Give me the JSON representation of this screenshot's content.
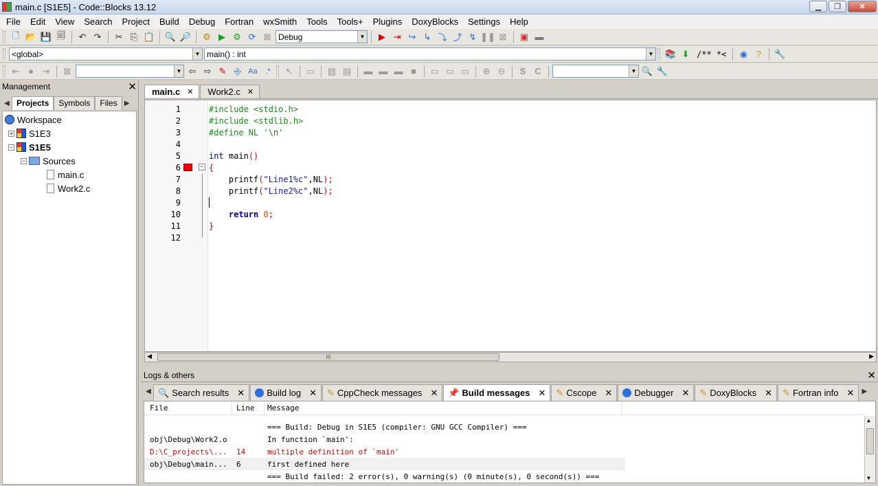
{
  "window": {
    "title": "main.c [S1E5] - Code::Blocks 13.12"
  },
  "menu": [
    "File",
    "Edit",
    "View",
    "Search",
    "Project",
    "Build",
    "Debug",
    "Fortran",
    "wxSmith",
    "Tools",
    "Tools+",
    "Plugins",
    "DoxyBlocks",
    "Settings",
    "Help"
  ],
  "toolbar": {
    "build_target": "Debug",
    "scope": "<global>",
    "function": "main() : int",
    "comment_label": "/** *<",
    "search_value": "",
    "find_value": ""
  },
  "management": {
    "title": "Management",
    "tabs": [
      "Projects",
      "Symbols",
      "Files"
    ],
    "tree": {
      "workspace": "Workspace",
      "projects": [
        "S1E3",
        "S1E5"
      ],
      "folder": "Sources",
      "files": [
        "main.c",
        "Work2.c"
      ]
    }
  },
  "editor": {
    "tabs": [
      "main.c",
      "Work2.c"
    ],
    "lines": [
      {
        "n": "1"
      },
      {
        "n": "2"
      },
      {
        "n": "3"
      },
      {
        "n": "4"
      },
      {
        "n": "5"
      },
      {
        "n": "6"
      },
      {
        "n": "7"
      },
      {
        "n": "8"
      },
      {
        "n": "9"
      },
      {
        "n": "10"
      },
      {
        "n": "11"
      },
      {
        "n": "12"
      }
    ],
    "code": {
      "l1": "#include <stdio.h>",
      "l2": "#include <stdlib.h>",
      "l3": "#define NL '\\n'",
      "l5a": "int",
      "l5b": " main",
      "l5c": "()",
      "l6": "{",
      "l7a": "    printf",
      "l7b": "(",
      "l7c": "\"Line1%c\"",
      "l7d": ",NL",
      "l7e": ");",
      "l8a": "    printf",
      "l8b": "(",
      "l8c": "\"Line2%c\"",
      "l8d": ",NL",
      "l8e": ");",
      "l10a": "    return",
      "l10b": " 0",
      "l10c": ";",
      "l11": "}"
    },
    "hscroll_label": "III"
  },
  "logs": {
    "title": "Logs & others",
    "tabs": [
      "Search results",
      "Build log",
      "CppCheck messages",
      "Build messages",
      "Cscope",
      "Debugger",
      "DoxyBlocks",
      "Fortran info"
    ],
    "columns": [
      "File",
      "Line",
      "Message"
    ],
    "rows": [
      {
        "file": "",
        "line": "",
        "message": "=== Build: Debug in S1E5 (compiler: GNU GCC Compiler) ==="
      },
      {
        "file": "obj\\Debug\\Work2.o",
        "line": "",
        "message": "In function `main':"
      },
      {
        "file": "D:\\C_projects\\...",
        "line": "14",
        "message": "multiple definition of `main'"
      },
      {
        "file": "obj\\Debug\\main...",
        "line": "6",
        "message": "first defined here"
      },
      {
        "file": "",
        "line": "",
        "message": "=== Build failed: 2 error(s), 0 warning(s) (0 minute(s), 0 second(s)) ==="
      }
    ]
  },
  "colors": {
    "error": "#dd0000",
    "preprocessor": "#1b8a1b",
    "keyword": "#00008b",
    "string": "#1a1aa6"
  }
}
